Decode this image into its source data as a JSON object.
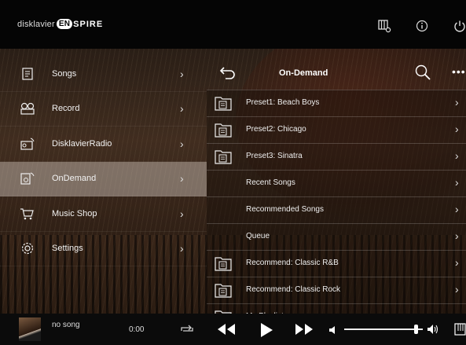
{
  "header": {
    "logo_prefix": "disklavier",
    "logo_en": "EN",
    "logo_suffix": "SPIRE",
    "icons": [
      "library-settings-icon",
      "info-icon",
      "power-icon"
    ]
  },
  "menu": {
    "items": [
      {
        "label": "Songs",
        "icon": "songs-icon",
        "active": false
      },
      {
        "label": "Record",
        "icon": "record-icon",
        "active": false
      },
      {
        "label": "DisklavierRadio",
        "icon": "radio-icon",
        "active": false
      },
      {
        "label": "OnDemand",
        "icon": "ondemand-icon",
        "active": true
      },
      {
        "label": "Music Shop",
        "icon": "cart-icon",
        "active": false
      },
      {
        "label": "Settings",
        "icon": "settings-icon",
        "active": false
      }
    ]
  },
  "panel": {
    "title": "On-Demand",
    "items": [
      {
        "label": "Preset1: Beach Boys",
        "icon": true
      },
      {
        "label": "Preset2: Chicago",
        "icon": true
      },
      {
        "label": "Preset3: Sinatra",
        "icon": true
      },
      {
        "label": "Recent Songs",
        "icon": false
      },
      {
        "label": "Recommended Songs",
        "icon": false
      },
      {
        "label": "Queue",
        "icon": false
      },
      {
        "label": "Recommend: Classic R&B",
        "icon": true
      },
      {
        "label": "Recommend: Classic Rock",
        "icon": true
      },
      {
        "label": "My Playlist",
        "icon": true
      }
    ]
  },
  "player": {
    "song": "no song",
    "time": "0:00",
    "volume": 0.93
  },
  "colors": {
    "active_menu_bg": "#cfc6bd",
    "header_bg": "#050505",
    "player_bg": "#0b0b0b"
  }
}
